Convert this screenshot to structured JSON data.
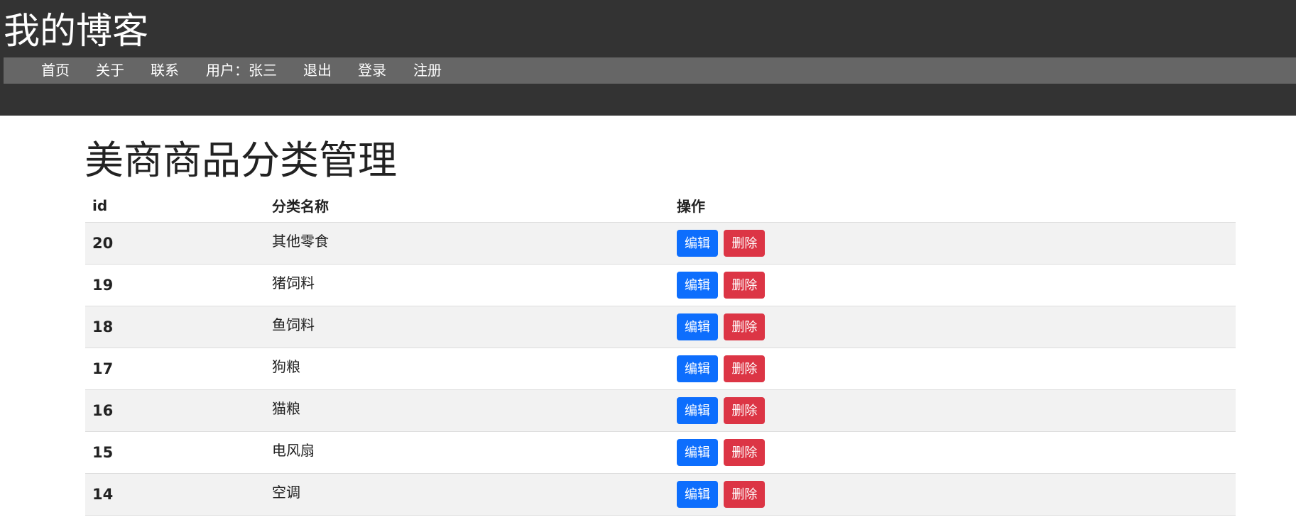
{
  "header": {
    "site_title": "我的博客",
    "background": "#333333",
    "nav_background": "#666666",
    "nav": [
      {
        "label": "首页"
      },
      {
        "label": "关于"
      },
      {
        "label": "联系"
      },
      {
        "label": "用户：张三"
      },
      {
        "label": "退出"
      },
      {
        "label": "登录"
      },
      {
        "label": "注册"
      }
    ]
  },
  "main": {
    "title": "美商商品分类管理",
    "table": {
      "columns": [
        "id",
        "分类名称",
        "操作"
      ],
      "edit_label": "编辑",
      "delete_label": "删除",
      "edit_color": "#0d6efd",
      "delete_color": "#dc3545",
      "rows": [
        {
          "id": "20",
          "name": "其他零食"
        },
        {
          "id": "19",
          "name": "猪饲料"
        },
        {
          "id": "18",
          "name": "鱼饲料"
        },
        {
          "id": "17",
          "name": "狗粮"
        },
        {
          "id": "16",
          "name": "猫粮"
        },
        {
          "id": "15",
          "name": "电风扇"
        },
        {
          "id": "14",
          "name": "空调"
        }
      ]
    }
  }
}
